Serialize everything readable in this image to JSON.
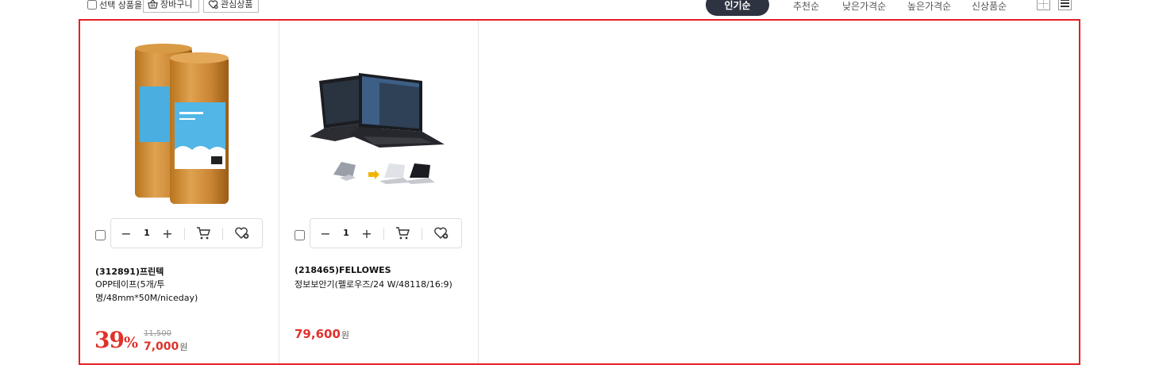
{
  "toolbar": {
    "select_label": "선택 상품을",
    "cart_button": "장바구니",
    "wish_button": "관심상품",
    "sort_options": [
      "인기순",
      "추천순",
      "낮은가격순",
      "높은가격순",
      "신상품순"
    ],
    "active_sort": "인기순"
  },
  "products": [
    {
      "code": "(312891)프린텍",
      "name": "OPP테이프(5개/투명/48mm*50M/niceday)",
      "quantity": "1",
      "discount": "39",
      "discount_unit": "%",
      "original_price": "11,500",
      "price": "7,000",
      "currency": "원"
    },
    {
      "code": "(218465)FELLOWES",
      "name": "정보보안기(펠로우즈/24 W/48118/16:9)",
      "quantity": "1",
      "price": "79,600",
      "currency": "원"
    }
  ],
  "colors": {
    "accent_red": "#e0312b",
    "frame_red": "#e41e26",
    "sort_active_bg": "#2d3340"
  },
  "icons": [
    "checkbox",
    "basket-icon",
    "heart-plus-icon",
    "cart-icon",
    "minus-icon",
    "plus-icon",
    "grid-view-icon",
    "list-view-icon"
  ]
}
